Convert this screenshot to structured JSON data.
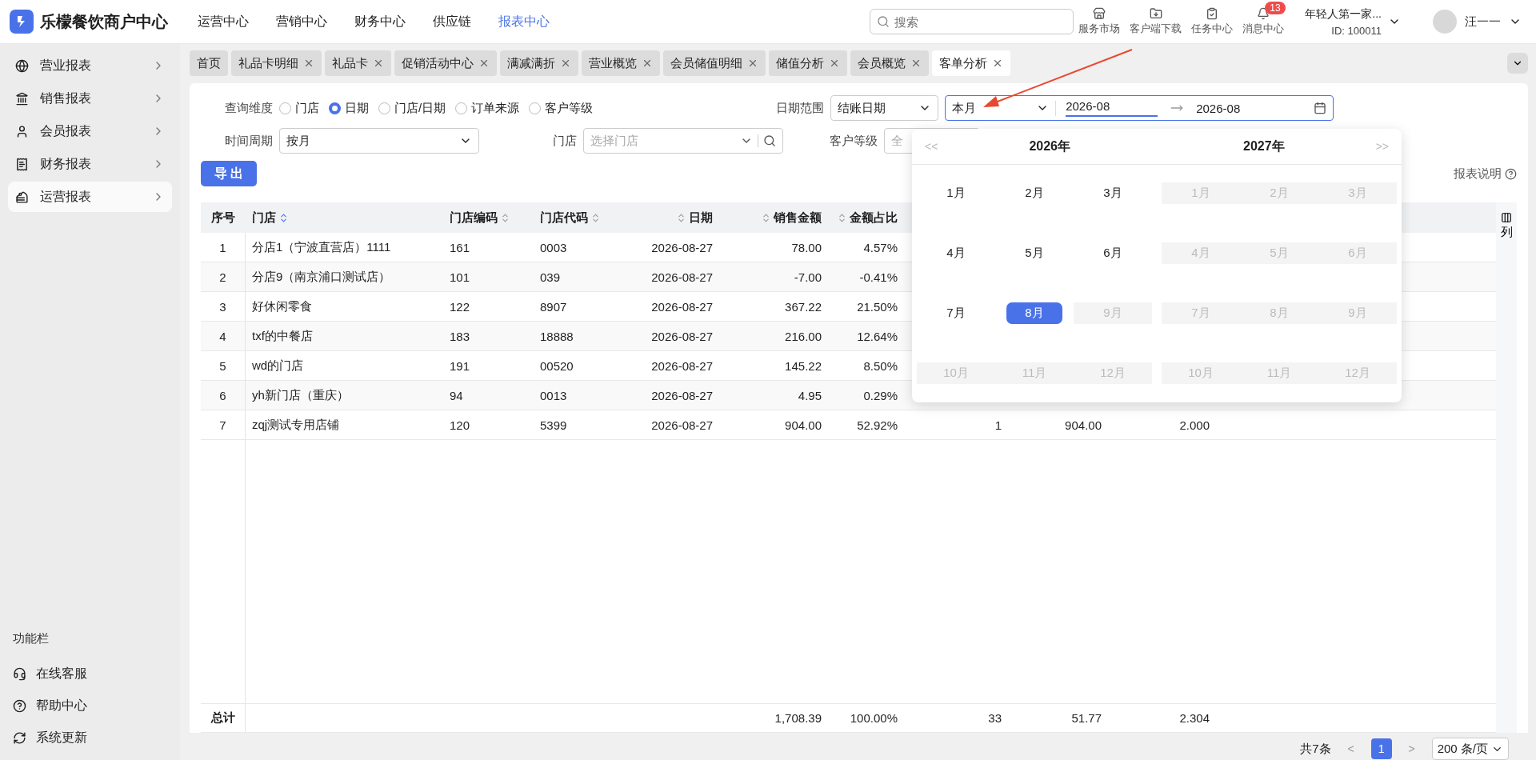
{
  "brand": {
    "name": "乐檬餐饮商户中心"
  },
  "top_nav": [
    {
      "label": "运营中心",
      "selected": false
    },
    {
      "label": "营销中心",
      "selected": false
    },
    {
      "label": "财务中心",
      "selected": false
    },
    {
      "label": "供应链",
      "selected": false
    },
    {
      "label": "报表中心",
      "selected": true
    }
  ],
  "search": {
    "placeholder": "搜索"
  },
  "tools": [
    {
      "label": "服务市场"
    },
    {
      "label": "客户端下载"
    },
    {
      "label": "任务中心"
    },
    {
      "label": "消息中心",
      "badge": "13"
    }
  ],
  "merchant": {
    "name": "年轻人第一家...",
    "id": "ID: 100011"
  },
  "user": {
    "name": "汪一一"
  },
  "sidebar": {
    "items": [
      {
        "label": "营业报表",
        "selected": false
      },
      {
        "label": "销售报表",
        "selected": false
      },
      {
        "label": "会员报表",
        "selected": false
      },
      {
        "label": "财务报表",
        "selected": false
      },
      {
        "label": "运营报表",
        "selected": true
      }
    ],
    "footer_title": "功能栏",
    "footer_items": [
      {
        "label": "在线客服"
      },
      {
        "label": "帮助中心"
      },
      {
        "label": "系统更新"
      }
    ]
  },
  "tabs": [
    {
      "label": "首页",
      "closable": false,
      "selected": false
    },
    {
      "label": "礼品卡明细",
      "closable": true,
      "selected": false
    },
    {
      "label": "礼品卡",
      "closable": true,
      "selected": false
    },
    {
      "label": "促销活动中心",
      "closable": true,
      "selected": false
    },
    {
      "label": "满减满折",
      "closable": true,
      "selected": false
    },
    {
      "label": "营业概览",
      "closable": true,
      "selected": false
    },
    {
      "label": "会员储值明细",
      "closable": true,
      "selected": false
    },
    {
      "label": "储值分析",
      "closable": true,
      "selected": false
    },
    {
      "label": "会员概览",
      "closable": true,
      "selected": false
    },
    {
      "label": "客单分析",
      "closable": true,
      "selected": true
    }
  ],
  "filters": {
    "dimension": {
      "label": "查询维度",
      "options": [
        {
          "label": "门店",
          "selected": false
        },
        {
          "label": "日期",
          "selected": true
        },
        {
          "label": "门店/日期",
          "selected": false
        },
        {
          "label": "订单来源",
          "selected": false
        },
        {
          "label": "客户等级",
          "selected": false
        }
      ]
    },
    "period": {
      "label": "时间周期",
      "value": "按月"
    },
    "store": {
      "label": "门店",
      "placeholder": "选择门店"
    },
    "date_range": {
      "label": "日期范围",
      "type": "结账日期",
      "preset": "本月",
      "start": "2026-08",
      "end": "2026-08",
      "start_active": true
    },
    "level": {
      "label": "客户等级",
      "placeholder": "全"
    }
  },
  "export_button": "导 出",
  "report_help": "报表说明",
  "table": {
    "columns": [
      {
        "label": "序号",
        "sortable": false
      },
      {
        "label": "门店",
        "sortable": true
      },
      {
        "label": "门店编码",
        "sortable": true
      },
      {
        "label": "门店代码",
        "sortable": true
      },
      {
        "label": "日期",
        "sortable": true
      },
      {
        "label": "销售金额",
        "sortable": true
      },
      {
        "label": "金额占比",
        "sortable": true
      }
    ],
    "column_settings": "列",
    "rows": [
      {
        "cells": [
          "1",
          "分店1（宁波直营店）1111",
          "161",
          "0003",
          "2026-08-27",
          "78.00",
          "4.57%",
          null,
          null,
          null
        ]
      },
      {
        "cells": [
          "2",
          "分店9（南京浦口测试店）",
          "101",
          "039",
          "2026-08-27",
          "-7.00",
          "-0.41%",
          null,
          null,
          null
        ]
      },
      {
        "cells": [
          "3",
          "好休闲零食",
          "122",
          "8907",
          "2026-08-27",
          "367.22",
          "21.50%",
          null,
          null,
          null
        ]
      },
      {
        "cells": [
          "4",
          "txf的中餐店",
          "183",
          "18888",
          "2026-08-27",
          "216.00",
          "12.64%",
          null,
          null,
          null
        ]
      },
      {
        "cells": [
          "5",
          "wd的门店",
          "191",
          "00520",
          "2026-08-27",
          "145.22",
          "8.50%",
          null,
          null,
          null
        ]
      },
      {
        "cells": [
          "6",
          "yh新门店（重庆）",
          "94",
          "0013",
          "2026-08-27",
          "4.95",
          "0.29%",
          null,
          null,
          null
        ]
      },
      {
        "cells": [
          "7",
          "zqj测试专用店铺",
          "120",
          "5399",
          "2026-08-27",
          "904.00",
          "52.92%",
          "1",
          "904.00",
          "2.000"
        ]
      }
    ],
    "total": {
      "cells": [
        "总计",
        null,
        null,
        null,
        null,
        "1,708.39",
        "100.00%",
        "33",
        "51.77",
        "2.304"
      ]
    }
  },
  "pagination": {
    "total": "共7条",
    "prev": "<",
    "pages": [
      {
        "label": "1",
        "selected": true
      }
    ],
    "next": ">",
    "page_size": "200 条/页"
  },
  "month_picker": {
    "prev": "<<",
    "next": ">>",
    "panels": [
      {
        "year": "2026年",
        "months": [
          {
            "label": "1月",
            "selected": false,
            "disabled": false
          },
          {
            "label": "2月",
            "selected": false,
            "disabled": false
          },
          {
            "label": "3月",
            "selected": false,
            "disabled": false
          },
          {
            "label": "4月",
            "selected": false,
            "disabled": false
          },
          {
            "label": "5月",
            "selected": false,
            "disabled": false
          },
          {
            "label": "6月",
            "selected": false,
            "disabled": false
          },
          {
            "label": "7月",
            "selected": false,
            "disabled": false
          },
          {
            "label": "8月",
            "selected": true,
            "disabled": false
          },
          {
            "label": "9月",
            "selected": false,
            "disabled": true
          },
          {
            "label": "10月",
            "selected": false,
            "disabled": true
          },
          {
            "label": "11月",
            "selected": false,
            "disabled": true
          },
          {
            "label": "12月",
            "selected": false,
            "disabled": true
          }
        ]
      },
      {
        "year": "2027年",
        "months": [
          {
            "label": "1月",
            "selected": false,
            "disabled": true
          },
          {
            "label": "2月",
            "selected": false,
            "disabled": true
          },
          {
            "label": "3月",
            "selected": false,
            "disabled": true
          },
          {
            "label": "4月",
            "selected": false,
            "disabled": true
          },
          {
            "label": "5月",
            "selected": false,
            "disabled": true
          },
          {
            "label": "6月",
            "selected": false,
            "disabled": true
          },
          {
            "label": "7月",
            "selected": false,
            "disabled": true
          },
          {
            "label": "8月",
            "selected": false,
            "disabled": true
          },
          {
            "label": "9月",
            "selected": false,
            "disabled": true
          },
          {
            "label": "10月",
            "selected": false,
            "disabled": true
          },
          {
            "label": "11月",
            "selected": false,
            "disabled": true
          },
          {
            "label": "12月",
            "selected": false,
            "disabled": true
          }
        ]
      }
    ]
  }
}
